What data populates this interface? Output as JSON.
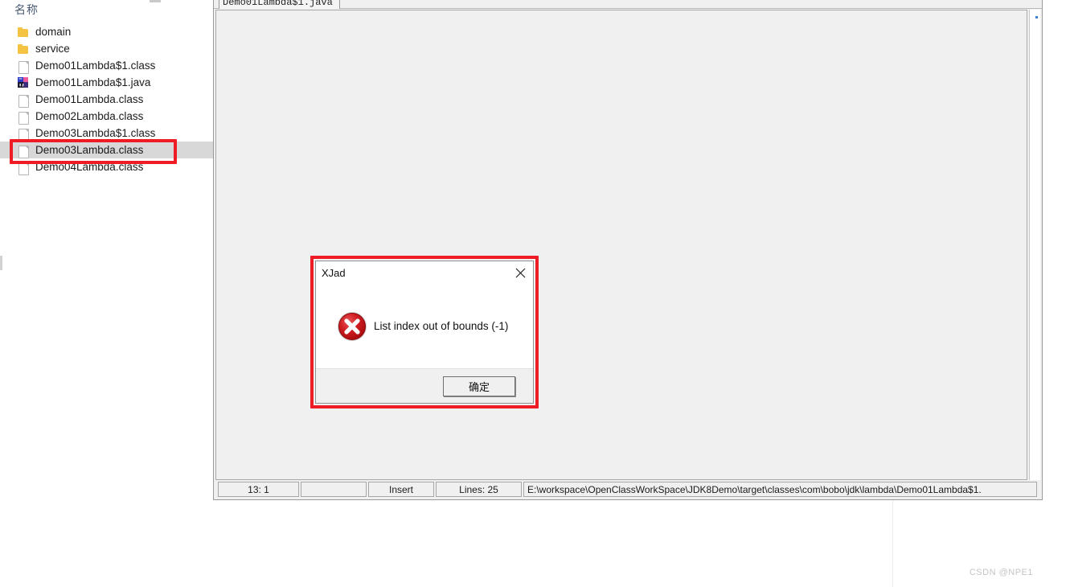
{
  "explorer": {
    "header_label": "名称",
    "files": [
      {
        "name": "domain",
        "icon": "folder-icon",
        "selected": false
      },
      {
        "name": "service",
        "icon": "folder-icon",
        "selected": false
      },
      {
        "name": "Demo01Lambda$1.class",
        "icon": "file-icon",
        "selected": false
      },
      {
        "name": "Demo01Lambda$1.java",
        "icon": "intellij-java-file-icon",
        "selected": false
      },
      {
        "name": "Demo01Lambda.class",
        "icon": "file-icon",
        "selected": false
      },
      {
        "name": "Demo02Lambda.class",
        "icon": "file-icon",
        "selected": false
      },
      {
        "name": "Demo03Lambda$1.class",
        "icon": "file-icon",
        "selected": false
      },
      {
        "name": "Demo03Lambda.class",
        "icon": "file-icon",
        "selected": true
      },
      {
        "name": "Demo04Lambda.class",
        "icon": "file-icon",
        "selected": false
      }
    ]
  },
  "editor": {
    "tab_label": "Demo01Lambda$1.java",
    "statusbar": {
      "position": "13:  1",
      "blank": "",
      "mode": "Insert",
      "lines": "Lines: 25",
      "path": "E:\\workspace\\OpenClassWorkSpace\\JDK8Demo\\target\\classes\\com\\bobo\\jdk\\lambda\\Demo01Lambda$1."
    }
  },
  "dialog": {
    "title": "XJad",
    "close_label": "✕",
    "message": "List index out of bounds (-1)",
    "ok_label": "确定",
    "error_icon": "error-circle-x-icon"
  },
  "annotations": {
    "accent_color": "#ee1c25"
  },
  "watermark": {
    "text": "CSDN @NPE1"
  }
}
